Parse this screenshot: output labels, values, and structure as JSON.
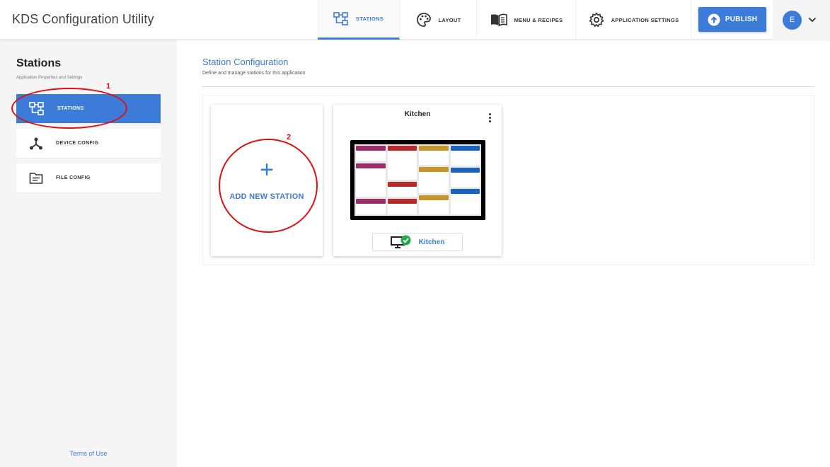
{
  "app": {
    "title": "KDS Configuration Utility"
  },
  "nav": {
    "tabs": [
      {
        "label": "STATIONS",
        "icon": "stations-icon",
        "active": true
      },
      {
        "label": "LAYOUT",
        "icon": "palette-icon"
      },
      {
        "label": "MENU & RECIPES",
        "icon": "book-icon"
      },
      {
        "label": "APPLICATION SETTINGS",
        "icon": "gear-icon"
      }
    ],
    "publish_label": "PUBLISH",
    "user_initial": "E"
  },
  "sidebar": {
    "title": "Stations",
    "subtitle": "Application Properties and Settings",
    "items": [
      {
        "label": "STATIONS",
        "icon": "stations-icon",
        "active": true
      },
      {
        "label": "DEVICE CONFIG",
        "icon": "device-hub-icon"
      },
      {
        "label": "FILE CONFIG",
        "icon": "file-icon"
      }
    ],
    "terms_label": "Terms of Use"
  },
  "main": {
    "title": "Station Configuration",
    "subtitle": "Define and manage stations for this application",
    "add_station_label": "ADD NEW STATION",
    "stations": [
      {
        "title": "Kitchen",
        "button_label": "Kitchen",
        "status": "online"
      }
    ]
  },
  "annotations": [
    {
      "number": "1"
    },
    {
      "number": "2"
    }
  ],
  "colors": {
    "accent": "#3d7bd9",
    "annotation": "#dd1111",
    "ticket_purple": "#9c2d6a",
    "ticket_red": "#b82a2a",
    "ticket_gold": "#c7962a",
    "ticket_blue": "#1a63c2",
    "status_green": "#23a84a"
  }
}
